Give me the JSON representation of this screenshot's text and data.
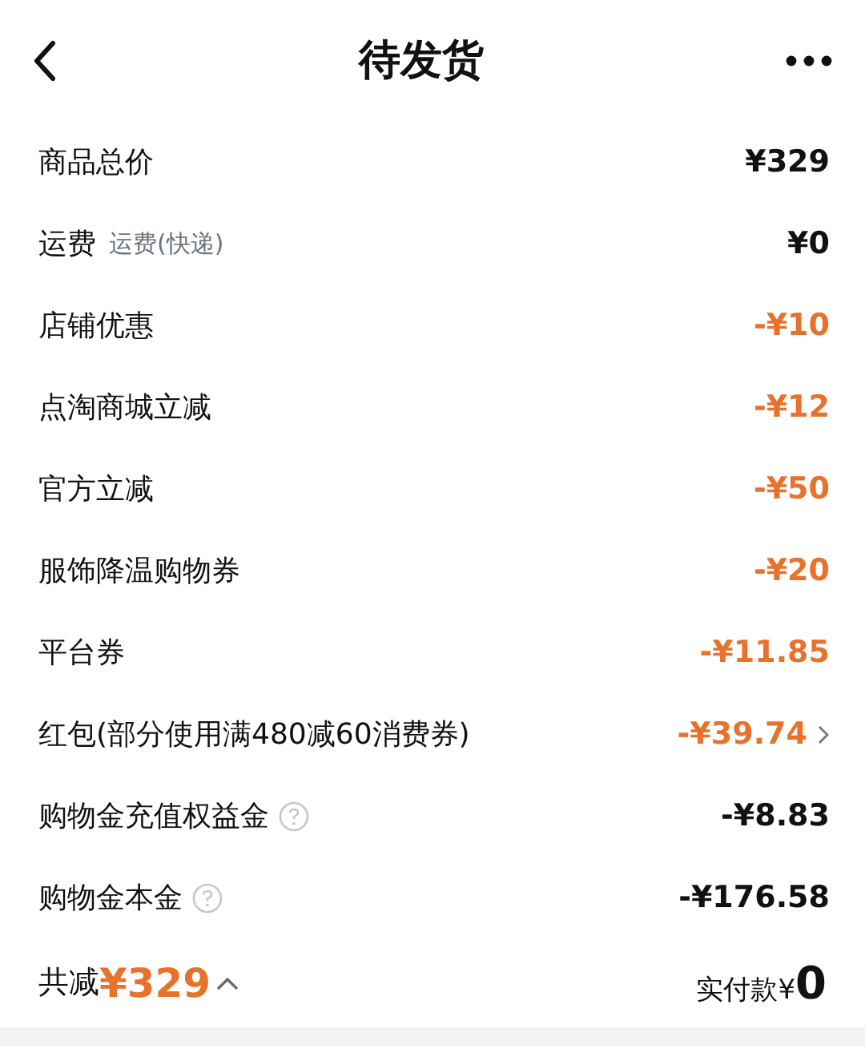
{
  "header": {
    "title": "待发货"
  },
  "rows": [
    {
      "label": "商品总价",
      "amount": "¥329",
      "highlight": false
    },
    {
      "label": "运费",
      "note": "运费(快递)",
      "amount": "¥0",
      "highlight": false
    },
    {
      "label": "店铺优惠",
      "amount": "-¥10",
      "highlight": true
    },
    {
      "label": "点淘商城立减",
      "amount": "-¥12",
      "highlight": true
    },
    {
      "label": "官方立减",
      "amount": "-¥50",
      "highlight": true
    },
    {
      "label": "服饰降温购物券",
      "amount": "-¥20",
      "highlight": true
    },
    {
      "label": "平台券",
      "amount": "-¥11.85",
      "highlight": true
    },
    {
      "label": "红包(部分使用满480减60消费券)",
      "amount": "-¥39.74",
      "highlight": true,
      "chevron": true
    },
    {
      "label": "购物金充值权益金",
      "amount": "-¥8.83",
      "highlight": false,
      "help": true
    },
    {
      "label": "购物金本金",
      "amount": "-¥176.58",
      "highlight": false,
      "help": true
    }
  ],
  "footer": {
    "reduction_label": "共减",
    "reduction_amount": "¥329",
    "paid_label": "实付款",
    "paid_currency": "¥",
    "paid_amount": "0"
  }
}
